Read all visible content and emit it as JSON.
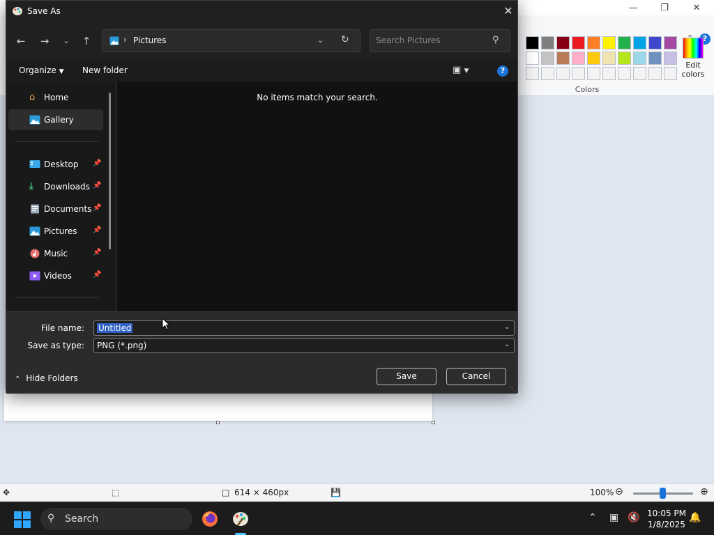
{
  "paint": {
    "ribbon": {
      "colors_label": "Colors",
      "edit_colors_label_1": "Edit",
      "edit_colors_label_2": "colors",
      "palette_row1": [
        "#000000",
        "#7f7f7f",
        "#880015",
        "#ed1c24",
        "#ff7f27",
        "#fff200",
        "#22b14c",
        "#00a2e8",
        "#3f48cc",
        "#a349a4"
      ],
      "palette_row2": [
        "#ffffff",
        "#c3c3c3",
        "#b97a57",
        "#ffaec9",
        "#ffc90e",
        "#efe4b0",
        "#b5e61d",
        "#99d9ea",
        "#7092be",
        "#c8bfe7"
      ],
      "palette_row3": [
        "#f3f3f3",
        "#f3f3f3",
        "#f3f3f3",
        "#f3f3f3",
        "#f3f3f3",
        "#f3f3f3",
        "#f3f3f3",
        "#f3f3f3",
        "#f3f3f3",
        "#f3f3f3"
      ]
    },
    "status": {
      "dimensions": "614 × 460px",
      "zoom": "100%"
    }
  },
  "dialog": {
    "title": "Save As",
    "address": {
      "location": "Pictures"
    },
    "search": {
      "placeholder": "Search Pictures"
    },
    "commands": {
      "organize": "Organize",
      "new_folder": "New folder"
    },
    "nav": {
      "top": [
        {
          "label": "Home",
          "icon": "home-icon"
        },
        {
          "label": "Gallery",
          "icon": "gallery-icon",
          "selected": true
        }
      ],
      "pinned": [
        {
          "label": "Desktop",
          "icon": "desktop-icon"
        },
        {
          "label": "Downloads",
          "icon": "downloads-icon"
        },
        {
          "label": "Documents",
          "icon": "documents-icon"
        },
        {
          "label": "Pictures",
          "icon": "pictures-icon"
        },
        {
          "label": "Music",
          "icon": "music-icon"
        },
        {
          "label": "Videos",
          "icon": "videos-icon"
        }
      ]
    },
    "empty_message": "No items match your search.",
    "file_name_label": "File name:",
    "file_name_value": "Untitled",
    "save_type_label": "Save as type:",
    "save_type_value": "PNG (*.png)",
    "hide_folders": "Hide Folders",
    "save_button": "Save",
    "cancel_button": "Cancel"
  },
  "taskbar": {
    "search_label": "Search",
    "time": "10:05 PM",
    "date": "1/8/2025"
  }
}
